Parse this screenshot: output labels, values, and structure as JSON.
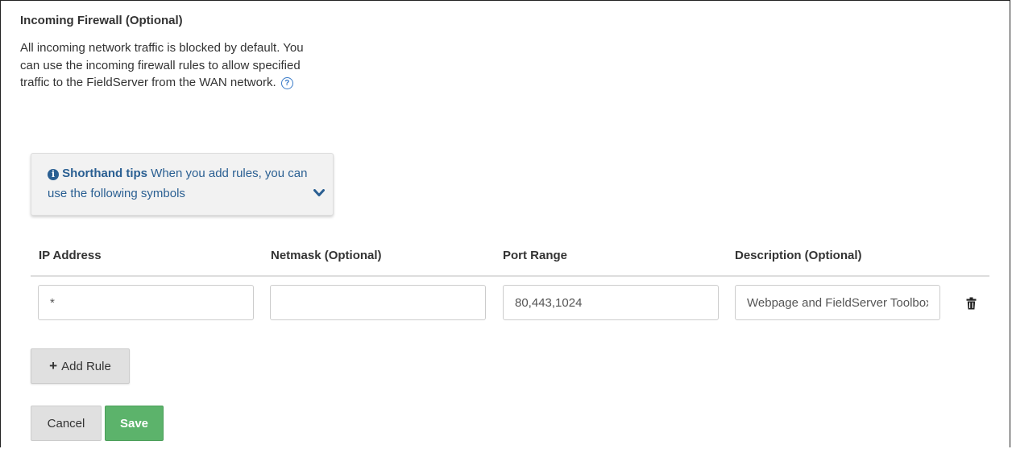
{
  "firewall": {
    "title": "Incoming Firewall (Optional)",
    "description": "All incoming network traffic is blocked by default. You can use the incoming firewall rules to allow specified traffic to the FieldServer from the WAN network.",
    "help_icon": "question-circle-icon"
  },
  "tips": {
    "icon": "info-circle-icon",
    "title": "Shorthand tips",
    "text": "When you add rules, you can use the following symbols",
    "expand_icon": "chevron-down-icon"
  },
  "table": {
    "columns": [
      "IP Address",
      "Netmask (Optional)",
      "Port Range",
      "Description (Optional)"
    ],
    "rows": [
      {
        "ip_address": "*",
        "netmask": "",
        "port_range": "80,443,1024",
        "description": "Webpage and FieldServer Toolbox",
        "delete_icon": "trash-icon"
      }
    ]
  },
  "actions": {
    "add_rule": "Add Rule",
    "add_icon": "plus-icon",
    "cancel": "Cancel",
    "save": "Save"
  },
  "colors": {
    "accent": "#2a5f92",
    "save": "#5cb36b",
    "help": "#3a7bc8"
  }
}
